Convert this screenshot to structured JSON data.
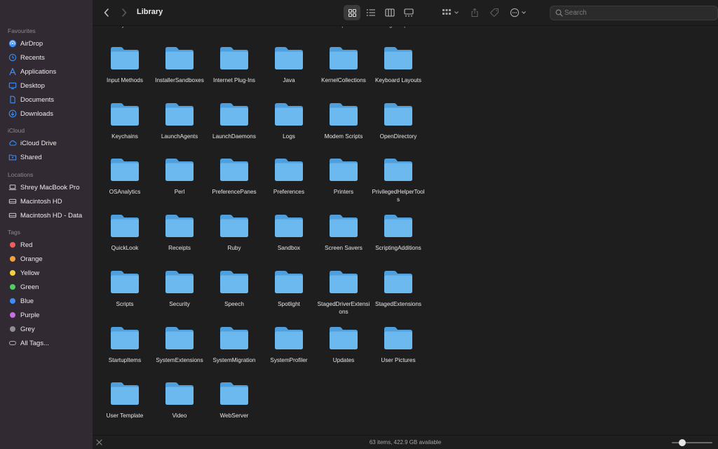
{
  "sidebar": {
    "favourites_header": "Favourites",
    "favourites": [
      {
        "label": "AirDrop",
        "icon": "airdrop-icon"
      },
      {
        "label": "Recents",
        "icon": "clock-icon"
      },
      {
        "label": "Applications",
        "icon": "applications-icon"
      },
      {
        "label": "Desktop",
        "icon": "desktop-icon"
      },
      {
        "label": "Documents",
        "icon": "document-icon"
      },
      {
        "label": "Downloads",
        "icon": "download-icon"
      }
    ],
    "icloud_header": "iCloud",
    "icloud": [
      {
        "label": "iCloud Drive",
        "icon": "cloud-icon"
      },
      {
        "label": "Shared",
        "icon": "shared-folder-icon"
      }
    ],
    "locations_header": "Locations",
    "locations": [
      {
        "label": "Shrey MacBook Pro",
        "icon": "laptop-icon"
      },
      {
        "label": "Macintosh HD",
        "icon": "drive-icon"
      },
      {
        "label": "Macintosh HD - Data",
        "icon": "drive-icon"
      }
    ],
    "tags_header": "Tags",
    "tags": [
      {
        "label": "Red",
        "color": "#ec5f5b"
      },
      {
        "label": "Orange",
        "color": "#f5a13a"
      },
      {
        "label": "Yellow",
        "color": "#f4d03f"
      },
      {
        "label": "Green",
        "color": "#4fce5d"
      },
      {
        "label": "Blue",
        "color": "#3b8ff6"
      },
      {
        "label": "Purple",
        "color": "#c86ee4"
      },
      {
        "label": "Grey",
        "color": "#8e8e93"
      },
      {
        "label": "All Tags...",
        "icon": "all-tags-icon"
      }
    ]
  },
  "toolbar": {
    "title": "Library",
    "search_placeholder": "Search"
  },
  "partial_row": [
    "Filesystems",
    "Fonts",
    "Frameworks",
    "GPUBundles",
    "Graphics",
    "Image Capture"
  ],
  "folders": [
    [
      "Input Methods",
      "InstallerSandboxes",
      "Internet Plug-Ins",
      "Java",
      "KernelCollections",
      "Keyboard Layouts"
    ],
    [
      "Keychains",
      "LaunchAgents",
      "LaunchDaemons",
      "Logs",
      "Modem Scripts",
      "OpenDirectory"
    ],
    [
      "OSAnalytics",
      "Perl",
      "PreferencePanes",
      "Preferences",
      "Printers",
      "PrivilegedHelperTools"
    ],
    [
      "QuickLook",
      "Receipts",
      "Ruby",
      "Sandbox",
      "Screen Savers",
      "ScriptingAdditions"
    ],
    [
      "Scripts",
      "Security",
      "Speech",
      "Spotlight",
      "StagedDriverExtensions",
      "StagedExtensions"
    ],
    [
      "StartupItems",
      "SystemExtensions",
      "SystemMigration",
      "SystemProfiler",
      "Updates",
      "User Pictures"
    ],
    [
      "User Template",
      "Video",
      "WebServer"
    ]
  ],
  "status": {
    "text": "63 items, 422.9 GB available",
    "zoom_level": 0.25
  },
  "colors": {
    "sidebar_bg": "#322a33",
    "window_bg": "#1e1e1e",
    "folder_front": "#6cb9ef",
    "folder_back": "#4f9fdc",
    "accent": "#3b8ff6"
  }
}
